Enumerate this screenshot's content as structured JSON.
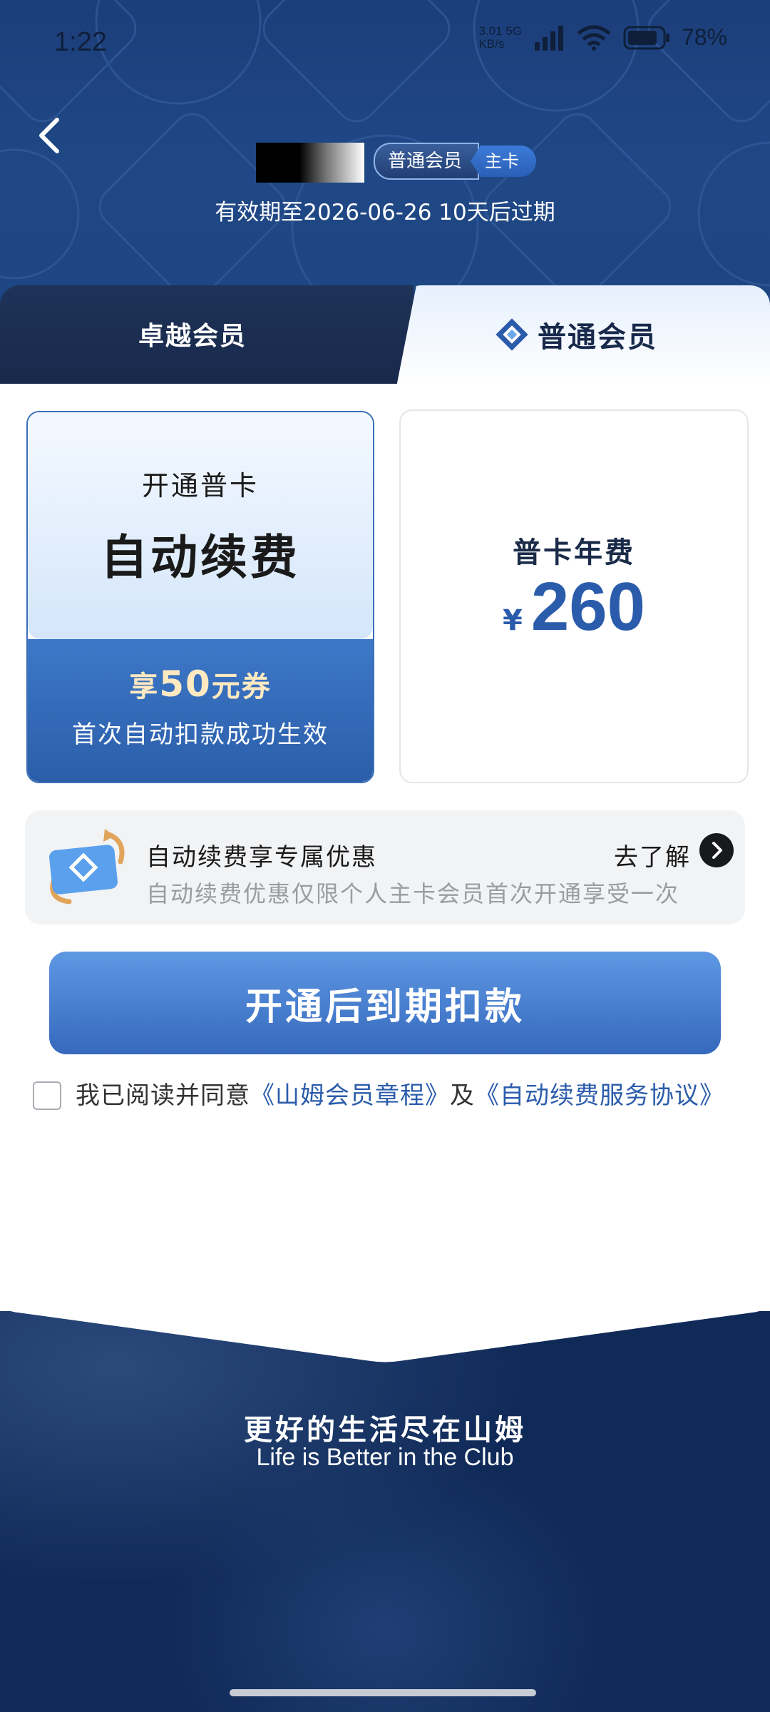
{
  "status_bar": {
    "time": "1:22",
    "net_speed_value": "3.01",
    "net_speed_unit": "KB/s",
    "network": "5G",
    "battery": "78%"
  },
  "header": {
    "tier_main": "普通会员",
    "tier_sub": "主卡",
    "expiry_text": "有效期至2026-06-26  10天后过期"
  },
  "tabs": [
    {
      "label": "卓越会员",
      "selected": false
    },
    {
      "label": "普通会员",
      "selected": true
    }
  ],
  "plans": {
    "auto_renew": {
      "title_line1": "开通普卡",
      "title_line2": "自动续费",
      "coupon_prefix": "享",
      "coupon_amount": "50",
      "coupon_suffix": "元券",
      "note": "首次自动扣款成功生效"
    },
    "annual": {
      "label": "普卡年费",
      "currency": "¥",
      "price": "260"
    }
  },
  "promo": {
    "title": "自动续费享专属优惠",
    "desc": "自动续费优惠仅限个人主卡会员首次开通享受一次",
    "more": "去了解"
  },
  "cta": {
    "label": "开通后到期扣款"
  },
  "agreement": {
    "prefix": "我已阅读并同意",
    "link1": "《山姆会员章程》",
    "joiner": "及",
    "link2": "《自动续费服务协议》"
  },
  "footer": {
    "slogan_cn": "更好的生活尽在山姆",
    "slogan_en": "Life is Better in the Club"
  },
  "colors": {
    "brand_blue": "#2b5cab",
    "dark_navy": "#18294b"
  }
}
